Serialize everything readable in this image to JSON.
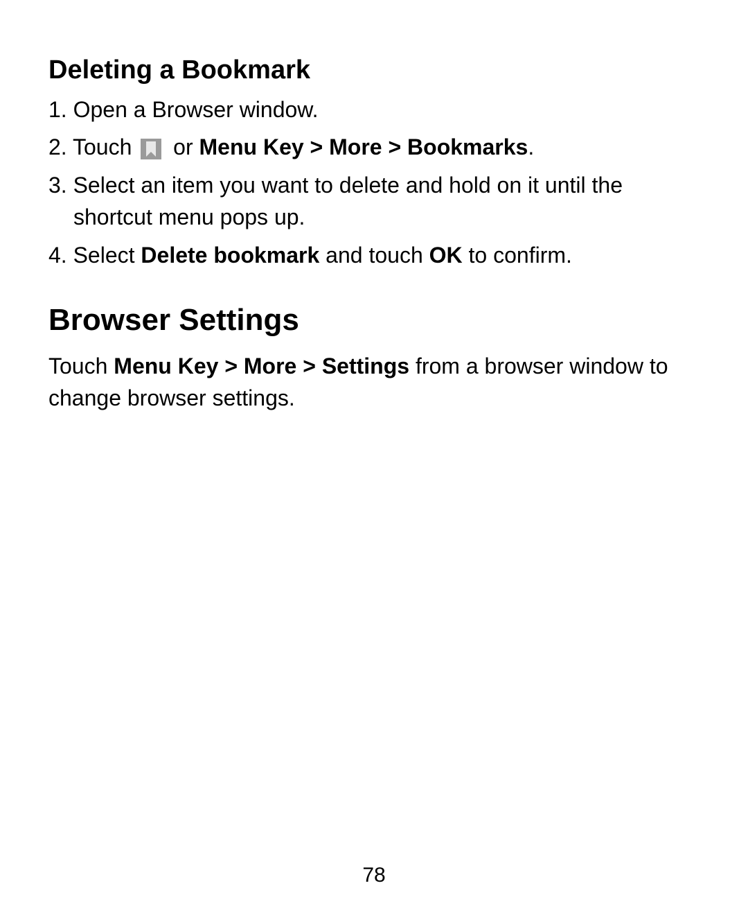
{
  "section1": {
    "heading": "Deleting a Bookmark",
    "steps": {
      "num1": "1.",
      "text1": "Open a Browser window.",
      "num2": "2.",
      "text2a": "Touch ",
      "text2b": " or ",
      "bold2": "Menu Key > More > Bookmarks",
      "text2c": ".",
      "num3": "3.",
      "text3": "Select an item you want to delete and hold on it until the shortcut menu pops up.",
      "num4": "4.",
      "text4a": "Select ",
      "bold4a": "Delete bookmark",
      "text4b": " and touch ",
      "bold4b": "OK",
      "text4c": " to confirm."
    }
  },
  "section2": {
    "heading": "Browser Settings",
    "body": {
      "text1": "Touch ",
      "bold1": "Menu Key > More > Settings",
      "text2": " from a browser window to change browser settings."
    }
  },
  "pageNumber": "78"
}
